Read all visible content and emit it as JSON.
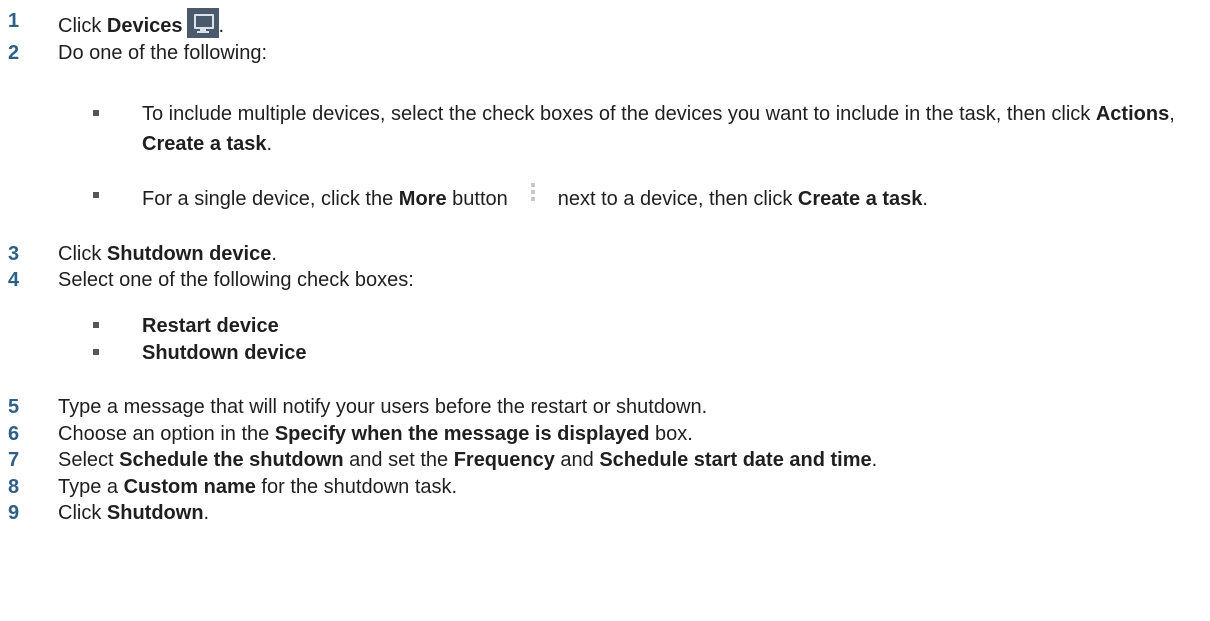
{
  "steps": [
    {
      "num": "1",
      "parts": [
        {
          "t": "Click ",
          "b": false
        },
        {
          "t": "Devices",
          "b": true
        }
      ],
      "after_icon": "."
    },
    {
      "num": "2",
      "parts": [
        {
          "t": "Do one of the following:",
          "b": false
        }
      ]
    },
    {
      "num": "3",
      "parts": [
        {
          "t": "Click ",
          "b": false
        },
        {
          "t": "Shutdown device",
          "b": true
        },
        {
          "t": ".",
          "b": false
        }
      ]
    },
    {
      "num": "4",
      "parts": [
        {
          "t": "Select one of the following check boxes:",
          "b": false
        }
      ]
    },
    {
      "num": "5",
      "parts": [
        {
          "t": "Type a message that will notify your users before the restart or shutdown.",
          "b": false
        }
      ]
    },
    {
      "num": "6",
      "parts": [
        {
          "t": "Choose an option in the ",
          "b": false
        },
        {
          "t": "Specify when the message is displayed",
          "b": true
        },
        {
          "t": " box.",
          "b": false
        }
      ]
    },
    {
      "num": "7",
      "parts": [
        {
          "t": "Select ",
          "b": false
        },
        {
          "t": "Schedule the shutdown",
          "b": true
        },
        {
          "t": " and set the ",
          "b": false
        },
        {
          "t": "Frequency",
          "b": true
        },
        {
          "t": " and ",
          "b": false
        },
        {
          "t": "Schedule start date and time",
          "b": true
        },
        {
          "t": ".",
          "b": false
        }
      ]
    },
    {
      "num": "8",
      "parts": [
        {
          "t": "Type a ",
          "b": false
        },
        {
          "t": "Custom name",
          "b": true
        },
        {
          "t": " for the shutdown task.",
          "b": false
        }
      ]
    },
    {
      "num": "9",
      "parts": [
        {
          "t": "Click ",
          "b": false
        },
        {
          "t": "Shutdown",
          "b": true
        },
        {
          "t": ".",
          "b": false
        }
      ]
    }
  ],
  "step2_bullets": [
    {
      "parts": [
        {
          "t": "To include multiple devices, select the check boxes of the devices you want to include in the task, then click ",
          "b": false
        },
        {
          "t": "Actions",
          "b": true
        },
        {
          "t": ", ",
          "b": false
        },
        {
          "t": "Create a task",
          "b": true
        },
        {
          "t": ".",
          "b": false
        }
      ]
    },
    {
      "parts_before": [
        {
          "t": "For a single device, click the ",
          "b": false
        },
        {
          "t": "More",
          "b": true
        },
        {
          "t": " button",
          "b": false
        }
      ],
      "parts_after": [
        {
          "t": "next to a device, then click ",
          "b": false
        },
        {
          "t": "Create a task",
          "b": true
        },
        {
          "t": ".",
          "b": false
        }
      ]
    }
  ],
  "step4_bullets": [
    {
      "parts": [
        {
          "t": "Restart device",
          "b": true
        }
      ]
    },
    {
      "parts": [
        {
          "t": "Shutdown device",
          "b": true
        }
      ]
    }
  ],
  "icons": {
    "devices": "monitor-icon",
    "more": "more-vertical-icon"
  },
  "colors": {
    "step_number": "#2e5f86",
    "devices_icon_bg": "#4a5a6b",
    "bullet": "#555555"
  }
}
